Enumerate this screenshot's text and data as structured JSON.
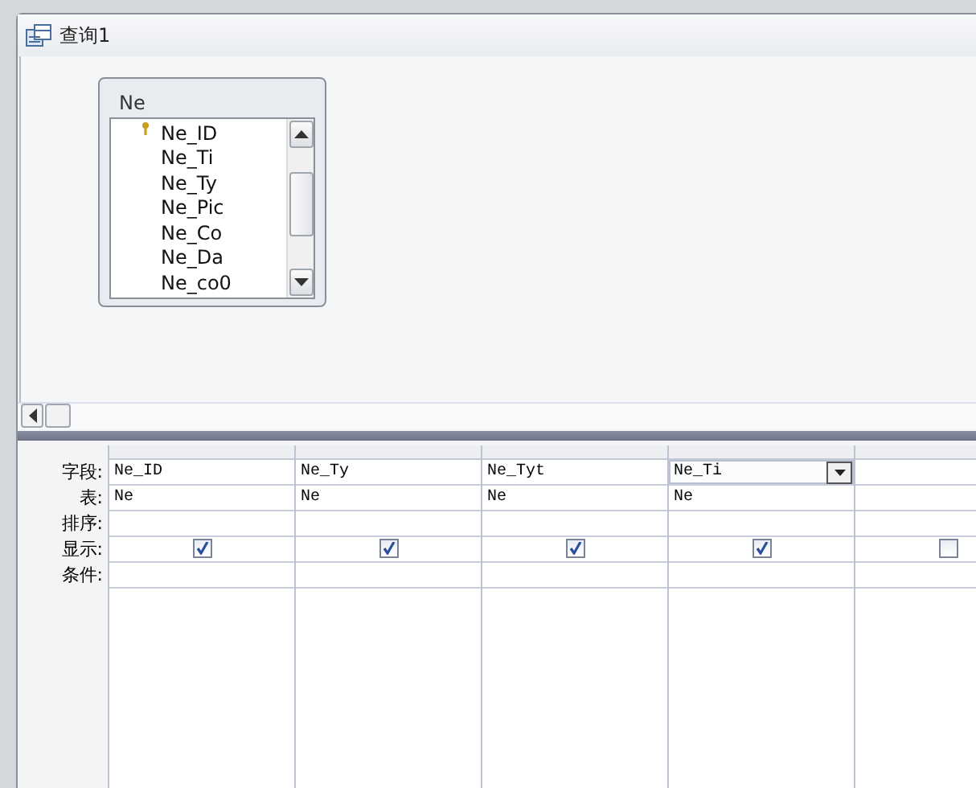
{
  "window": {
    "title": "查询1"
  },
  "table_box": {
    "title": "Ne",
    "fields": [
      {
        "name": "Ne_ID",
        "primary_key": true
      },
      {
        "name": "Ne_Ti",
        "primary_key": false
      },
      {
        "name": "Ne_Ty",
        "primary_key": false
      },
      {
        "name": "Ne_Pic",
        "primary_key": false
      },
      {
        "name": "Ne_Co",
        "primary_key": false
      },
      {
        "name": "Ne_Da",
        "primary_key": false
      },
      {
        "name": "Ne_co0",
        "primary_key": false
      }
    ]
  },
  "grid": {
    "row_labels": [
      "字段:",
      "表:",
      "排序:",
      "显示:",
      "条件:"
    ],
    "columns": [
      {
        "field": "Ne_ID",
        "table": "Ne",
        "show": true,
        "selected": false
      },
      {
        "field": "Ne_Ty",
        "table": "Ne",
        "show": true,
        "selected": false
      },
      {
        "field": "Ne_Tyt",
        "table": "Ne",
        "show": true,
        "selected": false
      },
      {
        "field": "Ne_Ti",
        "table": "Ne",
        "show": true,
        "selected": true
      },
      {
        "show": false,
        "selected": false
      }
    ]
  }
}
